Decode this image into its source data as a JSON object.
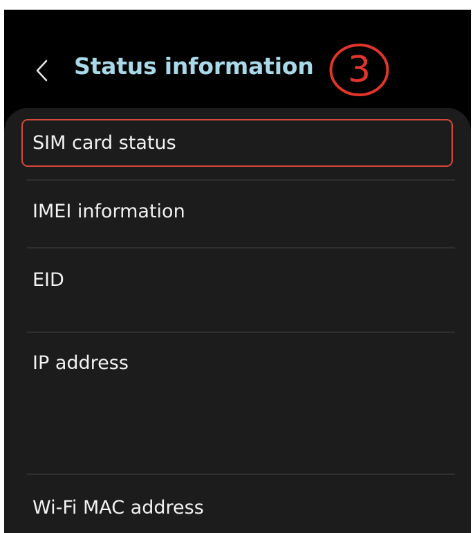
{
  "header": {
    "back_icon": "chevron-left-icon",
    "title": "Status information",
    "title_color": "#a9d9e8"
  },
  "annotation": {
    "step_number": "3",
    "color": "#e2352a"
  },
  "list": {
    "items": [
      {
        "label": "SIM card status",
        "highlighted": true
      },
      {
        "label": "IMEI information"
      },
      {
        "label": "EID"
      },
      {
        "label": "IP address"
      },
      {
        "label": "Wi-Fi MAC address"
      }
    ],
    "highlight_color": "#d8473d"
  },
  "colors": {
    "background": "#000000",
    "panel": "#1c1c1c",
    "text": "#f2f2f2"
  }
}
